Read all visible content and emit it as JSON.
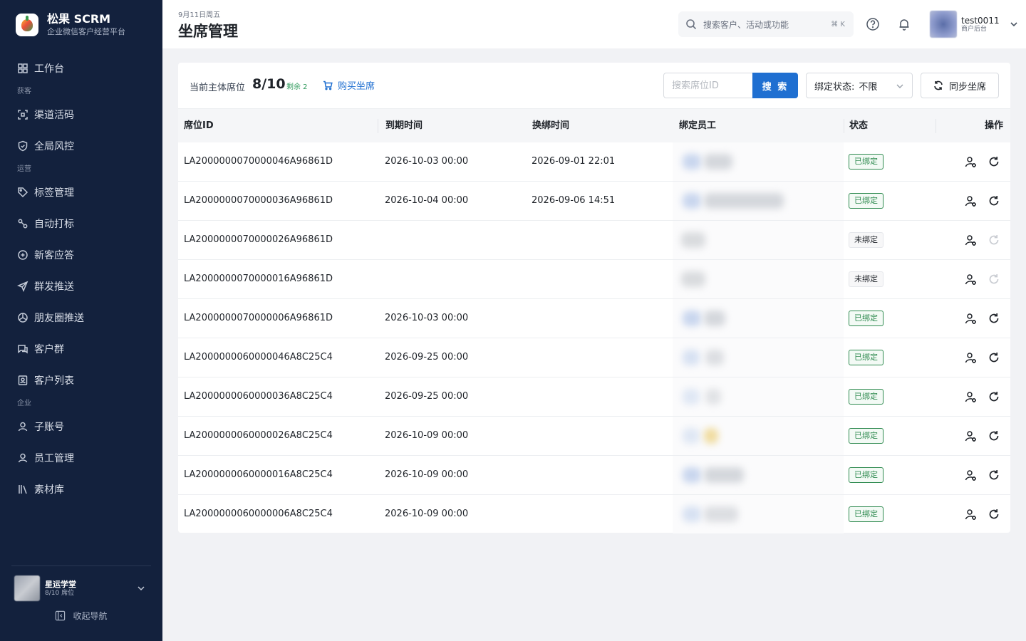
{
  "brand": {
    "name": "松果 SCRM",
    "subtitle": "企业微信客户经营平台"
  },
  "sidebar": {
    "items": [
      {
        "type": "item",
        "label": "工作台",
        "icon": "dashboard-icon"
      },
      {
        "type": "section",
        "label": "获客"
      },
      {
        "type": "item",
        "label": "渠道活码",
        "icon": "qrcode-icon"
      },
      {
        "type": "item",
        "label": "全局风控",
        "icon": "shield-icon"
      },
      {
        "type": "section",
        "label": "运营"
      },
      {
        "type": "item",
        "label": "标签管理",
        "icon": "tag-icon"
      },
      {
        "type": "item",
        "label": "自动打标",
        "icon": "auto-tag-icon"
      },
      {
        "type": "item",
        "label": "新客应答",
        "icon": "chat-reply-icon"
      },
      {
        "type": "item",
        "label": "群发推送",
        "icon": "send-icon"
      },
      {
        "type": "item",
        "label": "朋友圈推送",
        "icon": "moments-icon"
      },
      {
        "type": "item",
        "label": "客户群",
        "icon": "group-chat-icon"
      },
      {
        "type": "item",
        "label": "客户列表",
        "icon": "contact-list-icon"
      },
      {
        "type": "section",
        "label": "企业"
      },
      {
        "type": "item",
        "label": "子账号",
        "icon": "sub-account-icon"
      },
      {
        "type": "item",
        "label": "员工管理",
        "icon": "staff-icon"
      },
      {
        "type": "item",
        "label": "素材库",
        "icon": "library-icon"
      }
    ],
    "account": {
      "name": "星运学堂",
      "seats": "8/10 席位"
    },
    "collapse_label": "收起导航"
  },
  "header": {
    "date": "9月11日周五",
    "title": "坐席管理",
    "search_placeholder": "搜索客户、活动或功能",
    "search_shortcut": "⌘ K",
    "user": {
      "name": "test0011",
      "role": "商户后台"
    }
  },
  "toolbar": {
    "seat_label": "当前主体席位",
    "seat_count": "8/10",
    "remaining": "剩余 2",
    "buy_label": "购买坐席",
    "search_placeholder": "搜索席位ID",
    "search_button": "搜 索",
    "bind_filter_label": "绑定状态:",
    "bind_filter_value": "不限",
    "sync_label": "同步坐席"
  },
  "table": {
    "columns": [
      "席位ID",
      "到期时间",
      "换绑时间",
      "绑定员工",
      "状态",
      "操作"
    ],
    "rows": [
      {
        "seat_id": "LA2000000070000046A96861D",
        "expire": "2026-10-03 00:00",
        "rebind": "2026-09-01 22:01",
        "status": "已绑定",
        "bound": true
      },
      {
        "seat_id": "LA2000000070000036A96861D",
        "expire": "2026-10-04 00:00",
        "rebind": "2026-09-06 14:51",
        "status": "已绑定",
        "bound": true
      },
      {
        "seat_id": "LA2000000070000026A96861D",
        "expire": "",
        "rebind": "",
        "status": "未绑定",
        "bound": false
      },
      {
        "seat_id": "LA2000000070000016A96861D",
        "expire": "",
        "rebind": "",
        "status": "未绑定",
        "bound": false
      },
      {
        "seat_id": "LA2000000070000006A96861D",
        "expire": "2026-10-03 00:00",
        "rebind": "",
        "status": "已绑定",
        "bound": true
      },
      {
        "seat_id": "LA2000000060000046A8C25C4",
        "expire": "2026-09-25 00:00",
        "rebind": "",
        "status": "已绑定",
        "bound": true
      },
      {
        "seat_id": "LA2000000060000036A8C25C4",
        "expire": "2026-09-25 00:00",
        "rebind": "",
        "status": "已绑定",
        "bound": true
      },
      {
        "seat_id": "LA2000000060000026A8C25C4",
        "expire": "2026-10-09 00:00",
        "rebind": "",
        "status": "已绑定",
        "bound": true
      },
      {
        "seat_id": "LA2000000060000016A8C25C4",
        "expire": "2026-10-09 00:00",
        "rebind": "",
        "status": "已绑定",
        "bound": true
      },
      {
        "seat_id": "LA2000000060000006A8C25C4",
        "expire": "2026-10-09 00:00",
        "rebind": "",
        "status": "已绑定",
        "bound": true
      }
    ]
  },
  "colors": {
    "sidebar_bg": "#13213d",
    "accent": "#1f6fd1",
    "bound_green": "#2e8a4f",
    "page_bg": "#f1f2f5"
  }
}
